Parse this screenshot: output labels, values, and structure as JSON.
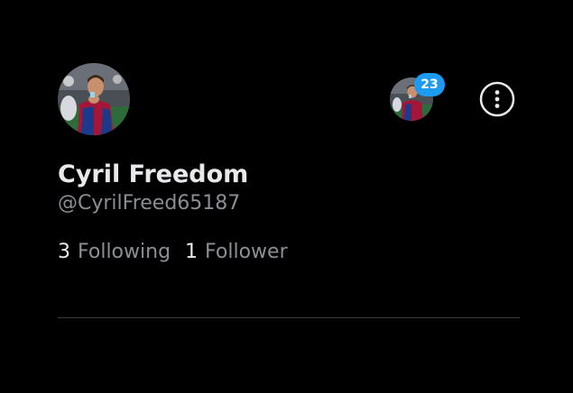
{
  "profile": {
    "display_name": "Cyril Freedom",
    "handle": "@CyrilFreed65187",
    "avatar_icon": "profile-photo"
  },
  "stats": {
    "following_count": "3",
    "following_label": "Following",
    "followers_count": "1",
    "followers_label": "Follower"
  },
  "account_switcher": {
    "notification_count": "23",
    "badge_color": "#1d9bf0"
  },
  "menu": {
    "more_icon": "more-vertical-icon"
  }
}
